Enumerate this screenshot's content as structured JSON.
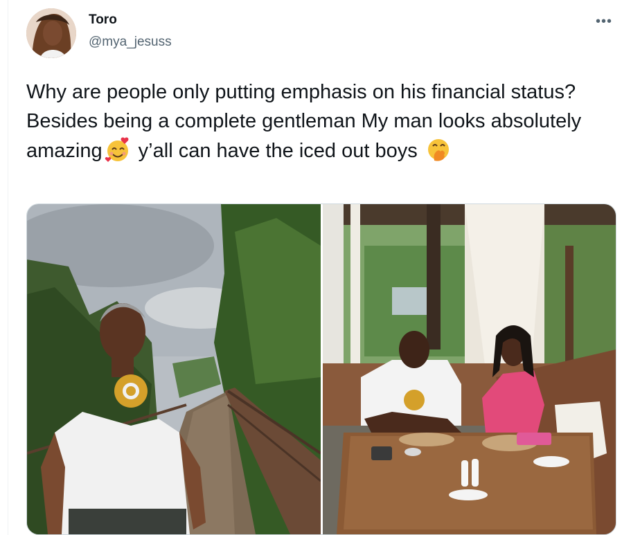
{
  "tweet": {
    "author_name": "Toro",
    "author_handle": "@mya_jesuss",
    "more_label": "•••",
    "text_before_emoji1": "Why are people only putting emphasis on his financial status? Besides being a complete gentleman My man looks absolutely amazing",
    "text_between": " y’all can have the iced out boys ",
    "emoji1": "smiling-face-with-hearts",
    "emoji2": "face-with-hand-over-mouth"
  },
  "media": {
    "count": 2
  },
  "colors": {
    "text_primary": "#0f1419",
    "text_secondary": "#536471",
    "border": "#cfd9de"
  }
}
